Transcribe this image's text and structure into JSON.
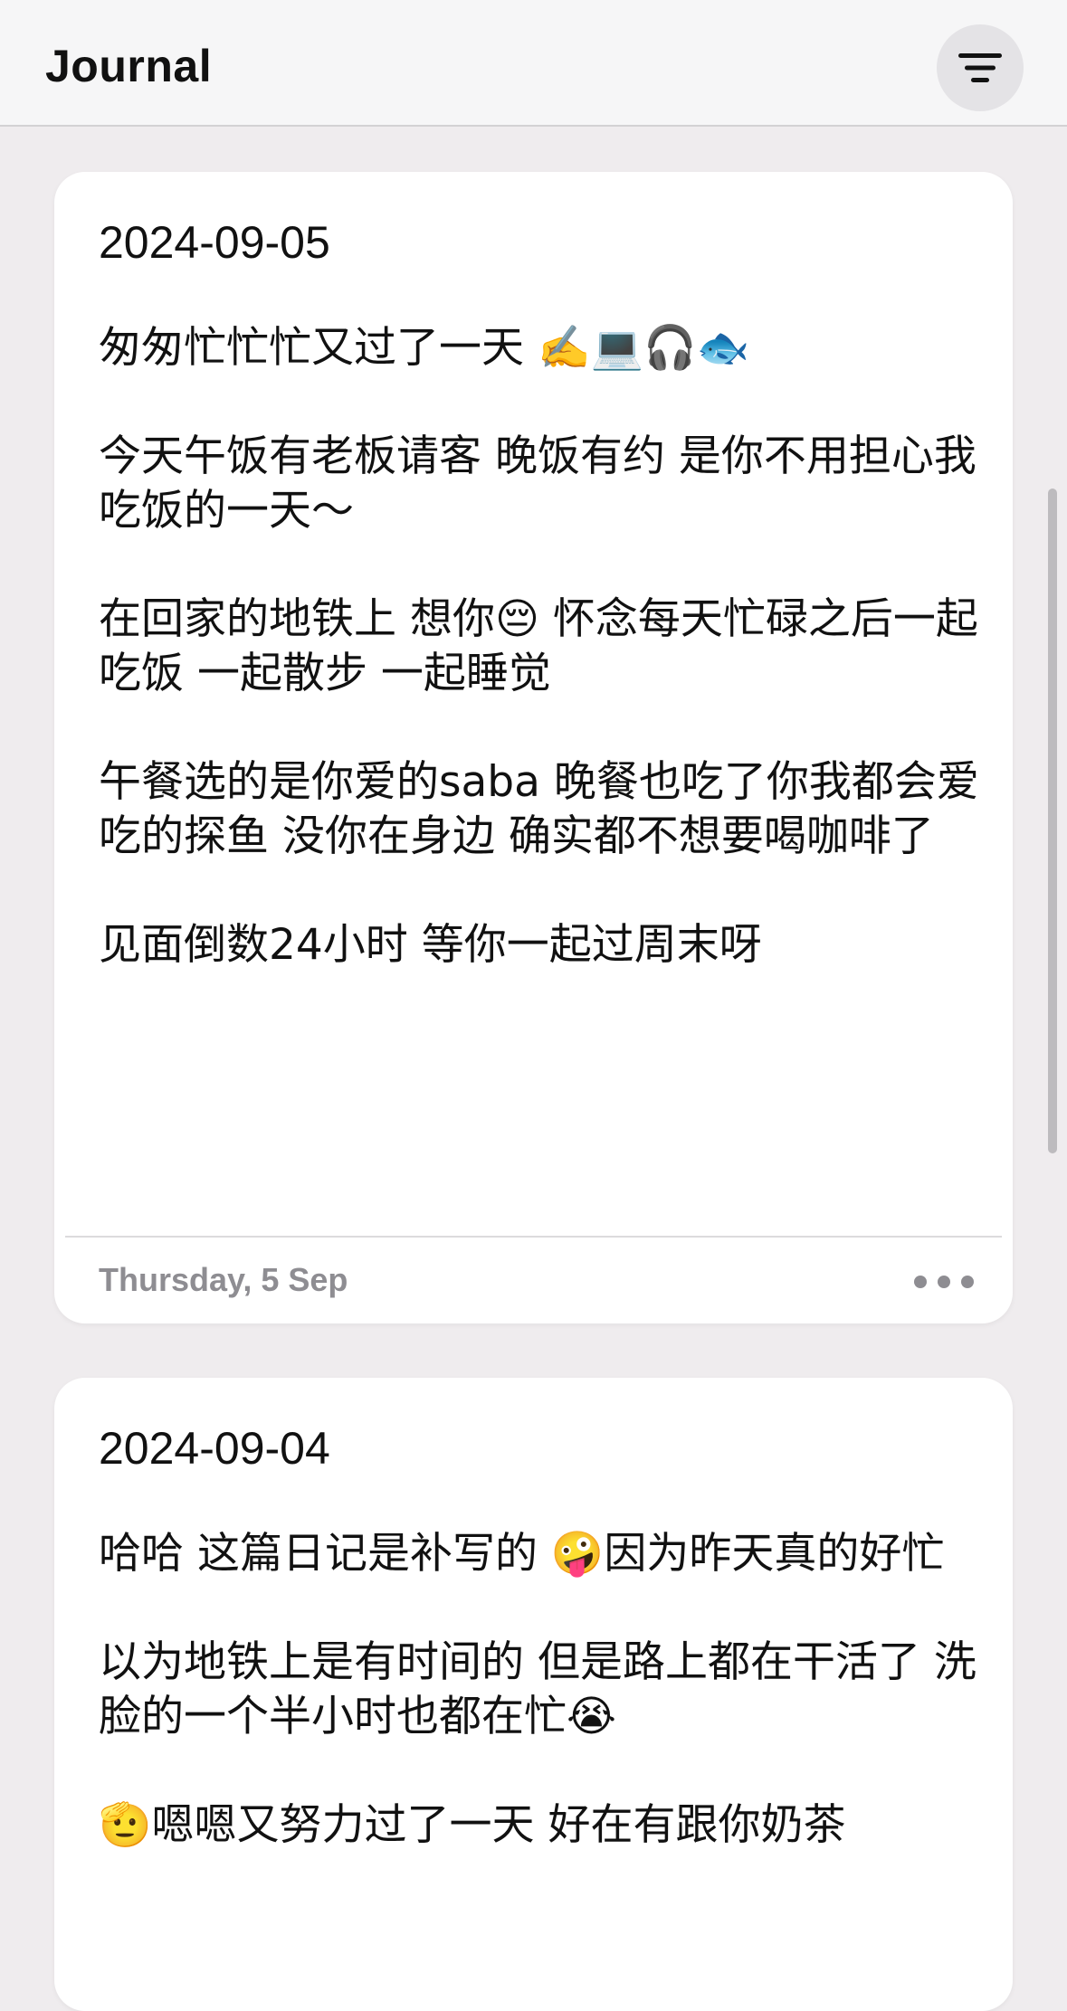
{
  "nav": {
    "title": "Journal",
    "filter_icon": "filter-lines-icon"
  },
  "entries": [
    {
      "title": "2024-09-05",
      "paragraphs": [
        "匆匆忙忙忙又过了一天 ✍️💻🎧🐟",
        "今天午饭有老板请客 晚饭有约 是你不用担心我吃饭的一天～",
        "在回家的地铁上 想你😔 怀念每天忙碌之后一起吃饭 一起散步 一起睡觉",
        "午餐选的是你爱的saba 晚餐也吃了你我都会爱吃的探鱼 没你在身边 确实都不想要喝咖啡了",
        "见面倒数24小时 等你一起过周末呀"
      ],
      "date": "Thursday, 5 Sep",
      "more_icon": "ellipsis-icon"
    },
    {
      "title": "2024-09-04",
      "paragraphs": [
        "哈哈 这篇日记是补写的 🤪因为昨天真的好忙",
        "以为地铁上是有时间的 但是路上都在干活了 洗脸的一个半小时也都在忙😭",
        "🫡嗯嗯又努力过了一天 好在有跟你奶茶"
      ]
    }
  ],
  "colors": {
    "background": "#efecee",
    "card": "#ffffff",
    "secondary_text": "#8e8d92"
  }
}
